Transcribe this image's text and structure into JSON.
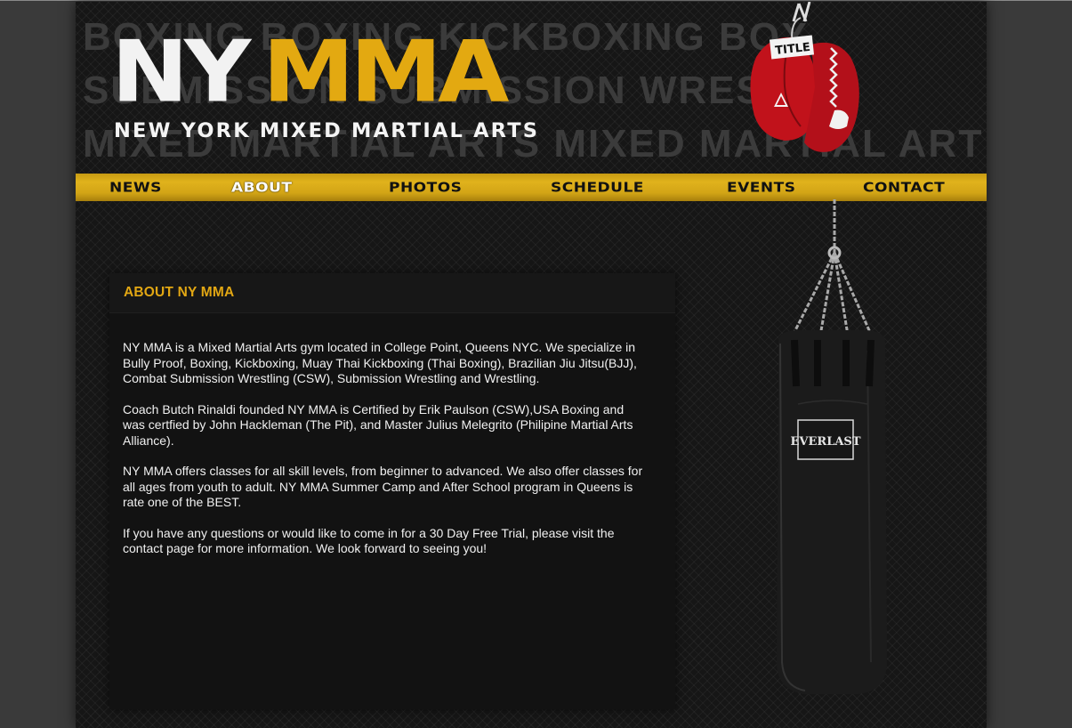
{
  "header": {
    "logo_ny": "NY",
    "logo_mma": "MMA",
    "logo_subtitle": "NEW YORK MIXED MARTIAL ARTS",
    "background_words": [
      "BOXING BOXING KICKBOXING BOX",
      "SUBMISSION SUBMISSION WREST",
      "MIXED MARTIAL ARTS MIXED MARTIAL ARTS M"
    ],
    "gloves_brand": "TITLE"
  },
  "nav": {
    "items": [
      {
        "label": "NEWS"
      },
      {
        "label": "ABOUT"
      },
      {
        "label": "PHOTOS"
      },
      {
        "label": "SCHEDULE"
      },
      {
        "label": "EVENTS"
      },
      {
        "label": "CONTACT"
      }
    ],
    "active": "ABOUT"
  },
  "content": {
    "title": "ABOUT NY MMA",
    "paragraphs": [
      "NY MMA is a Mixed Martial Arts gym located in College Point, Queens NYC. We specialize in Bully Proof, Boxing, Kickboxing, Muay Thai Kickboxing (Thai Boxing), Brazilian Jiu Jitsu(BJJ), Combat Submission Wrestling (CSW), Submission Wrestling and Wrestling.",
      "Coach Butch Rinaldi founded NY MMA is Certified by Erik Paulson (CSW),USA Boxing and was certfied by John Hackleman (The Pit), and Master Julius Melegrito (Philipine Martial Arts Alliance).",
      "NY MMA offers classes for all skill levels, from beginner to advanced. We also offer classes for all ages from youth to adult. NY MMA Summer Camp and After School program in Queens is rate one of the BEST.",
      "If you have any questions or would like to come in for a 30 Day Free Trial, please visit the contact page for more information. We look forward to seeing you!"
    ]
  },
  "bag": {
    "brand": "EVERLAST"
  },
  "colors": {
    "accent": "#e3a911",
    "page_background": "#161616",
    "outer_background": "#3a3a3a",
    "text": "#f0f0f0"
  }
}
